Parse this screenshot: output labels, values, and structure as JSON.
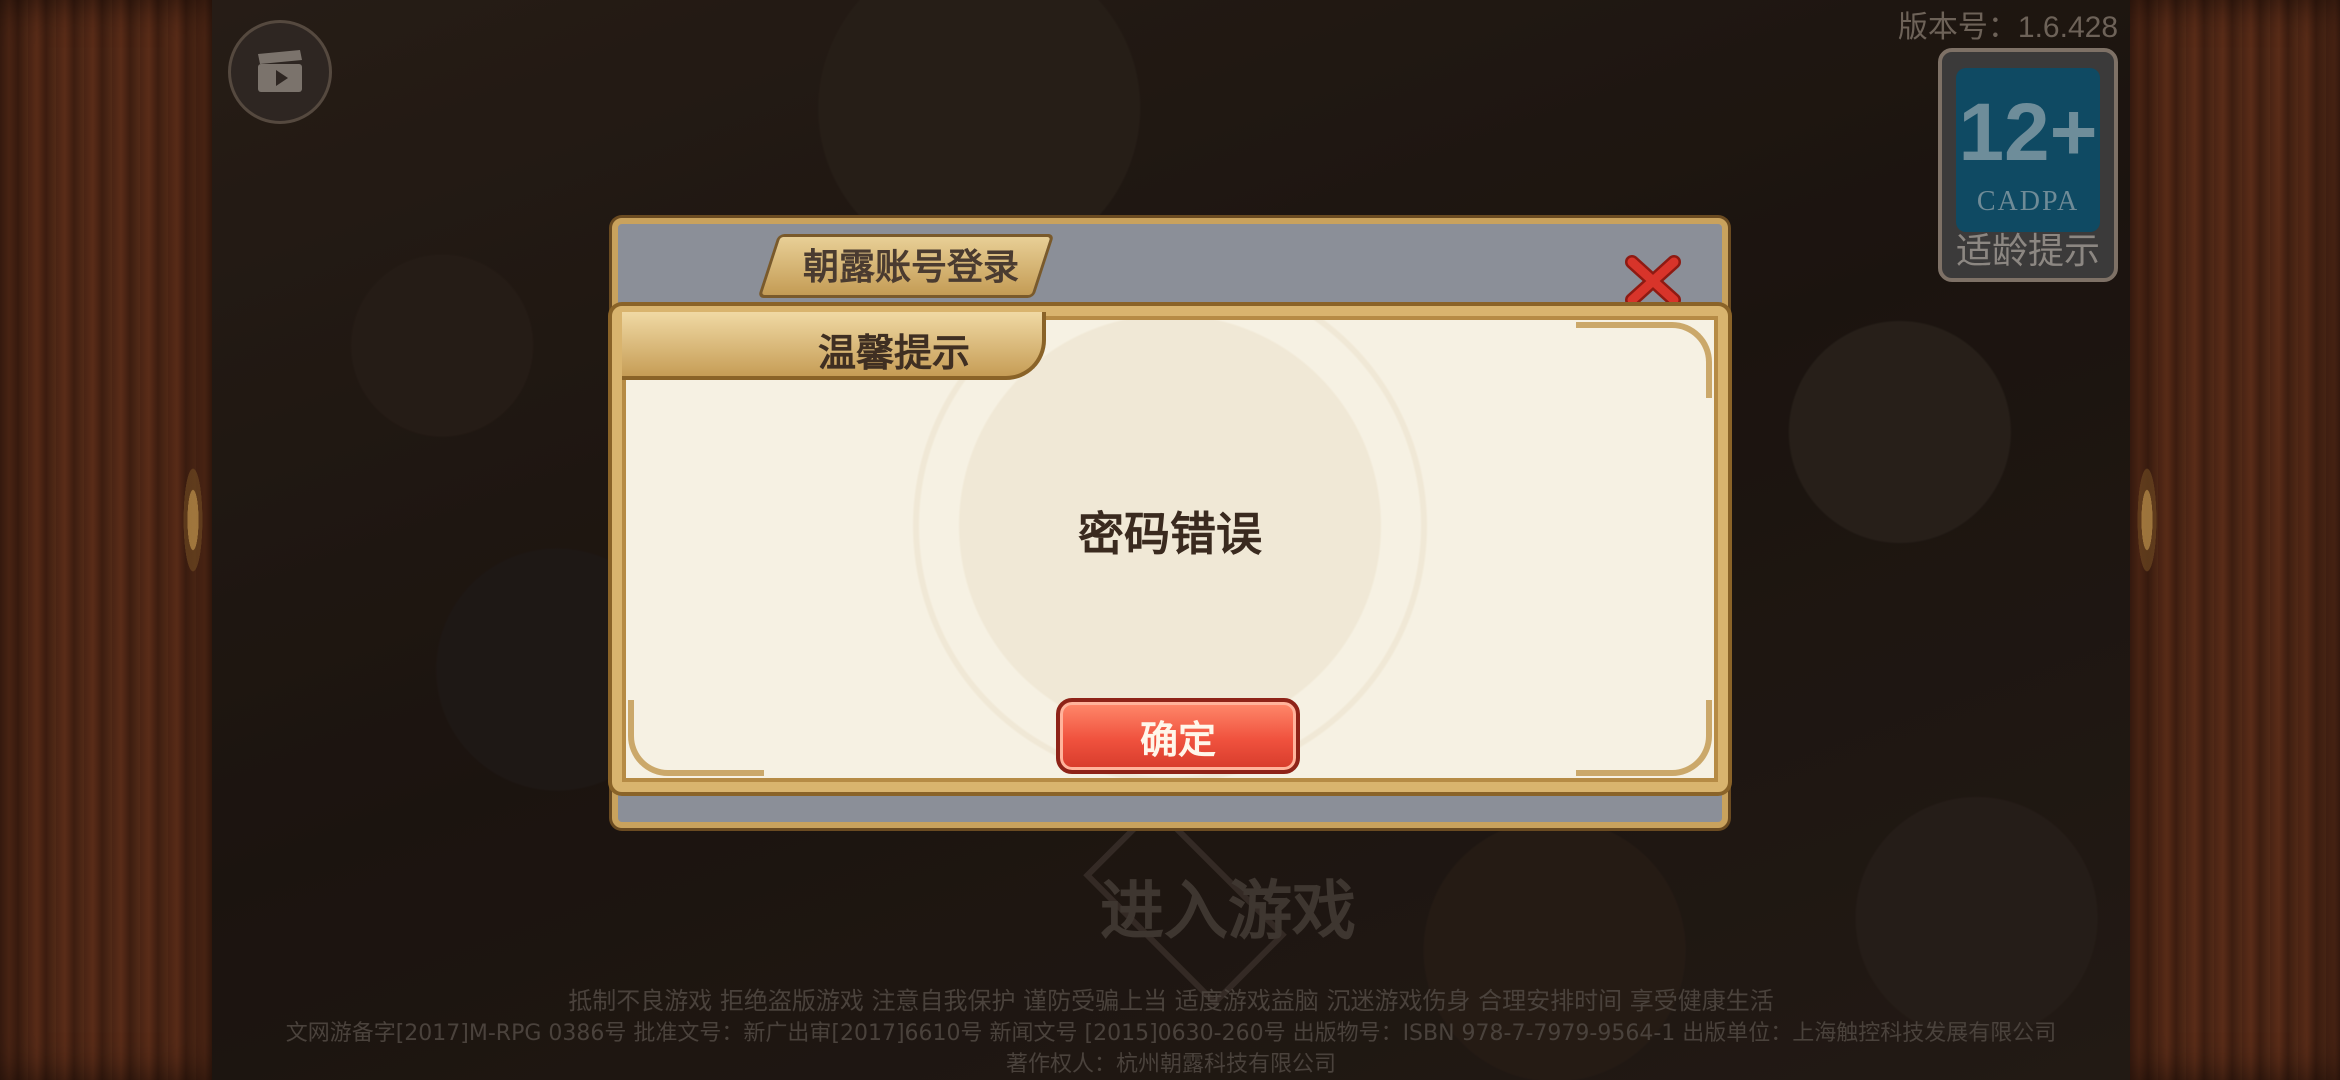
{
  "version": "版本号：1.6.428",
  "age_badge": {
    "rating": "12+",
    "org": "CADPA",
    "tip": "适龄提示"
  },
  "background": {
    "enter_game": "进入游戏"
  },
  "login_panel": {
    "title": "朝露账号登录"
  },
  "tip_dialog": {
    "title": "温馨提示",
    "message": "密码错误",
    "confirm_label": "确定"
  },
  "footer": {
    "line1": "抵制不良游戏 拒绝盗版游戏 注意自我保护 谨防受骗上当 适度游戏益脑 沉迷游戏伤身 合理安排时间 享受健康生活",
    "line2": "文网游备字[2017]M-RPG 0386号 批准文号：新广出审[2017]6610号 新闻文号 [2015]0630-260号 出版物号：ISBN 978-7-7979-9564-1 出版单位：上海触控科技发展有限公司",
    "line3": "著作权人：杭州朝露科技有限公司"
  },
  "icons": {
    "video": "clapperboard-icon",
    "close": "close-icon"
  },
  "colors": {
    "confirm_button": "#f0523e",
    "close_x": "#d8342a",
    "dialog_bg": "#f6f1e3",
    "frame_gold": "#d9b46e"
  }
}
